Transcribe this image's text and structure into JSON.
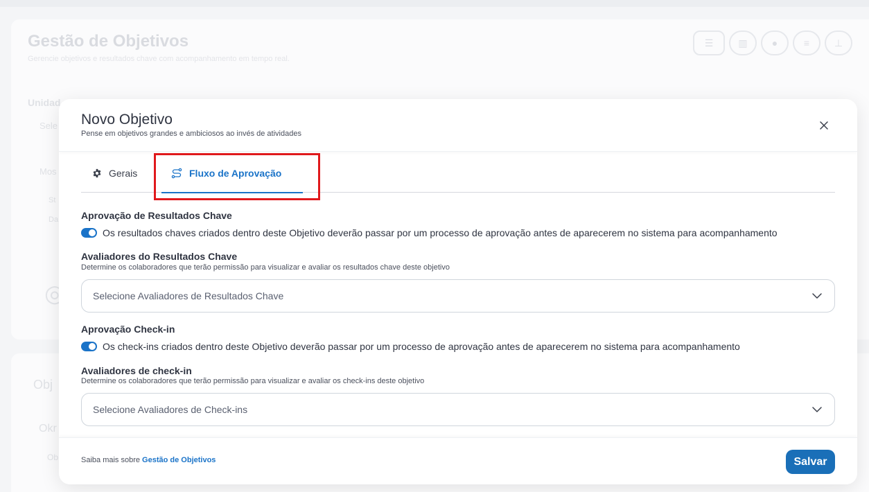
{
  "background": {
    "title": "Gestão de Objetivos",
    "subtitle": "Gerencie objetivos e resultados chave com acompanhamento em tempo real.",
    "frag_unidade": "Unidad",
    "frag_sele": "Sele",
    "frag_mos": "Mos",
    "frag_st": "St",
    "frag_da": "Da",
    "frag_obj": "Obj",
    "frag_okr": "Okr",
    "frag_ob": "Ob"
  },
  "modal": {
    "title": "Novo Objetivo",
    "subtitle": "Pense em objetivos grandes e ambiciosos ao invés de atividades",
    "close_icon": "close-icon"
  },
  "tabs": [
    {
      "label": "Gerais",
      "icon": "gear-icon",
      "active": false
    },
    {
      "label": "Fluxo de Aprovação",
      "icon": "flow-icon",
      "active": true
    }
  ],
  "form": {
    "kr_approval": {
      "label": "Aprovação de Resultados Chave",
      "toggle_on": true,
      "toggle_text": "Os resultados chaves criados dentro deste Objetivo deverão passar por um processo de aprovação antes de aparecerem no sistema para acompanhamento"
    },
    "kr_reviewers": {
      "label": "Avaliadores do Resultados Chave",
      "helper": "Determine os colaboradores que terão permissão para visualizar e avaliar os resultados chave deste objetivo",
      "placeholder": "Selecione Avaliadores de Resultados Chave"
    },
    "checkin_approval": {
      "label": "Aprovação Check-in",
      "toggle_on": true,
      "toggle_text": "Os check-ins criados dentro deste Objetivo deverão passar por um processo de aprovação antes de aparecerem no sistema para acompanhamento"
    },
    "checkin_reviewers": {
      "label": "Avaliadores de check-in",
      "helper": "Determine os colaboradores que terão permissão para visualizar e avaliar os check-ins deste objetivo",
      "placeholder": "Selecione Avaliadores de Check-ins"
    }
  },
  "footer": {
    "text_prefix": "Saiba mais sobre ",
    "link": "Gestão de Objetivos",
    "save_label": "Salvar"
  },
  "colors": {
    "accent": "#1a73c8",
    "save_button": "#1a6fb8",
    "highlight": "#e0191c"
  }
}
